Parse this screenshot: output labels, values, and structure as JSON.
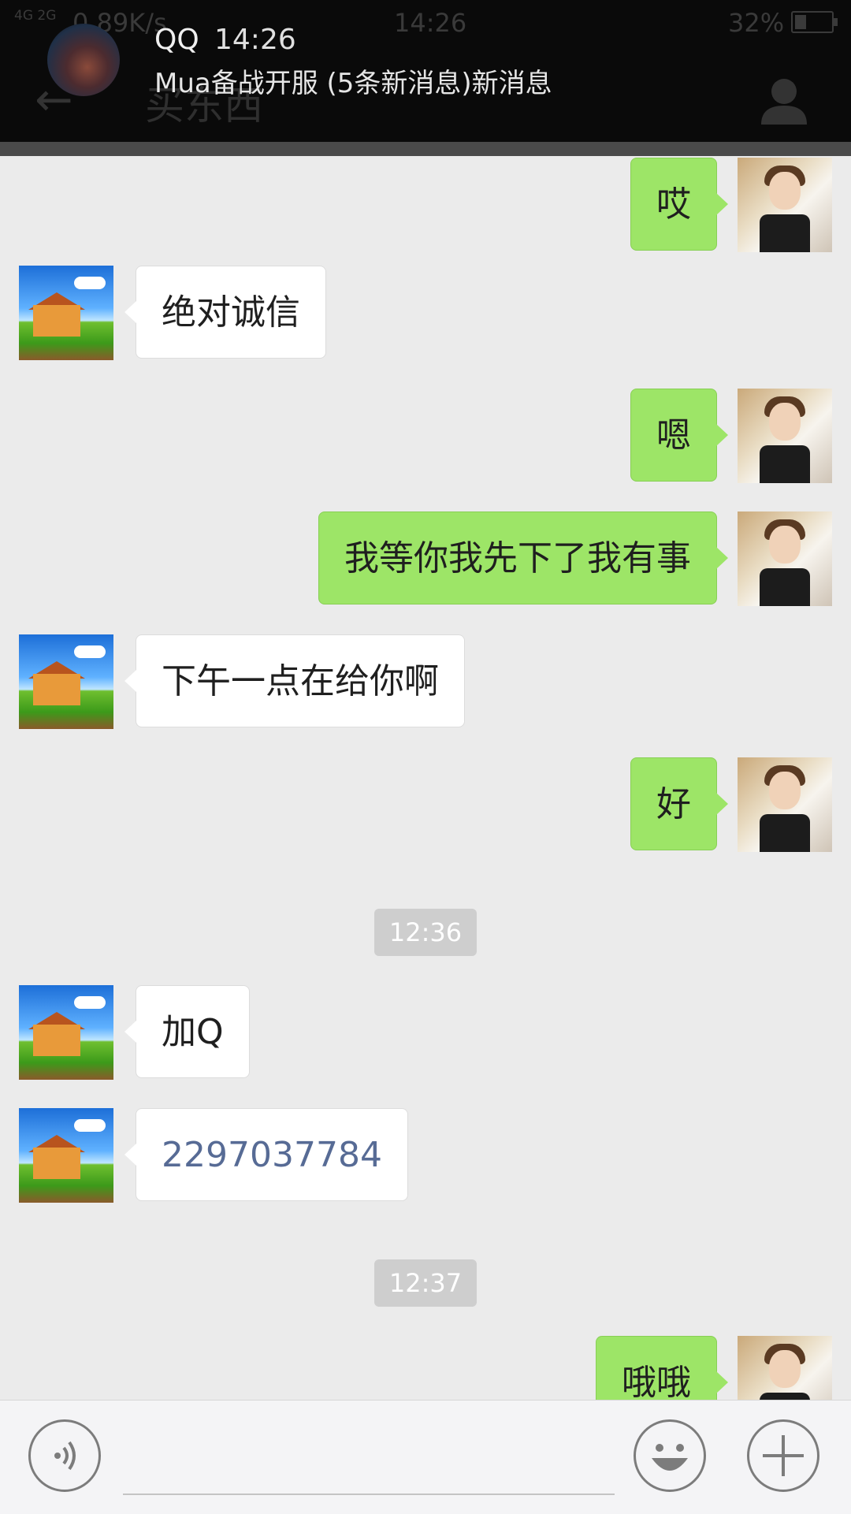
{
  "status_bar": {
    "signal": "4G 2G",
    "net_speed": "0.89K/s",
    "time": "14:26",
    "battery": "32%"
  },
  "header": {
    "title": "买东西"
  },
  "notification": {
    "app": "QQ",
    "time": "14:26",
    "message": "Mua备战开服 (5条新消息)新消息"
  },
  "messages": [
    {
      "from": "me",
      "text": "哎"
    },
    {
      "from": "them",
      "text": "绝对诚信"
    },
    {
      "from": "me",
      "text": "嗯"
    },
    {
      "from": "me",
      "text": "我等你我先下了我有事"
    },
    {
      "from": "them",
      "text": "下午一点在给你啊"
    },
    {
      "from": "me",
      "text": "好"
    },
    {
      "type": "timestamp",
      "text": "12:36"
    },
    {
      "from": "them",
      "text": "加Q"
    },
    {
      "from": "them",
      "text": "2297037784"
    },
    {
      "type": "timestamp",
      "text": "12:37"
    },
    {
      "from": "me",
      "text": "哦哦"
    }
  ],
  "input_bar": {
    "voice_icon": "voice-icon",
    "emoji_icon": "emoji-icon",
    "plus_icon": "plus-icon"
  },
  "colors": {
    "my_bubble": "#9de567",
    "their_bubble": "#ffffff",
    "chat_bg": "#ebebeb",
    "link_text": "#576b95"
  }
}
